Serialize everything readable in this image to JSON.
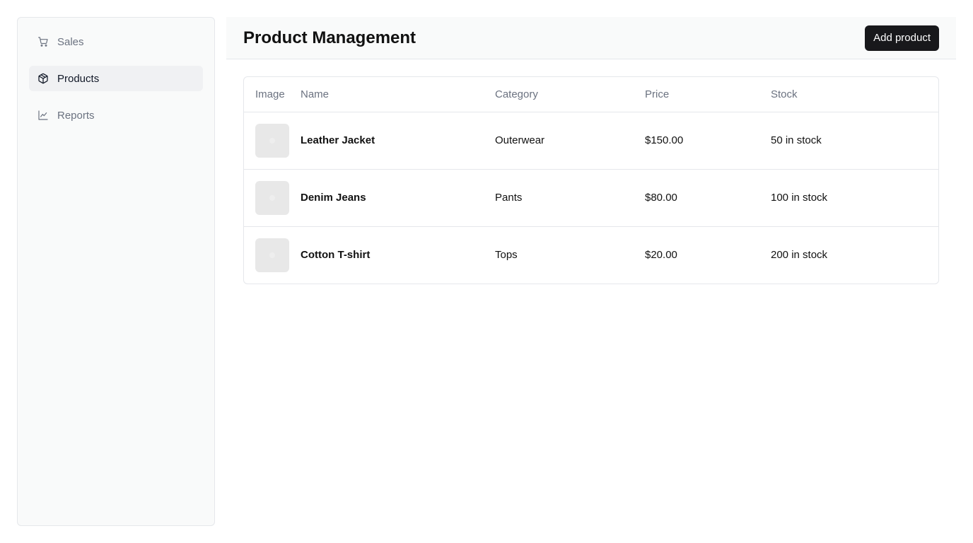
{
  "sidebar": {
    "items": [
      {
        "label": "Sales",
        "icon": "cart-icon",
        "active": false
      },
      {
        "label": "Products",
        "icon": "package-icon",
        "active": true
      },
      {
        "label": "Reports",
        "icon": "line-chart-icon",
        "active": false
      }
    ]
  },
  "header": {
    "title": "Product Management",
    "add_button_label": "Add product"
  },
  "table": {
    "columns": [
      "Image",
      "Name",
      "Category",
      "Price",
      "Stock"
    ],
    "rows": [
      {
        "name": "Leather Jacket",
        "category": "Outerwear",
        "price": "$150.00",
        "stock": "50 in stock"
      },
      {
        "name": "Denim Jeans",
        "category": "Pants",
        "price": "$80.00",
        "stock": "100 in stock"
      },
      {
        "name": "Cotton T-shirt",
        "category": "Tops",
        "price": "$20.00",
        "stock": "200 in stock"
      }
    ]
  },
  "colors": {
    "primary_button": "#18181b",
    "sidebar_bg": "#f9fafa",
    "active_item_bg": "#f0f1f3",
    "muted_text": "#6b7280"
  }
}
